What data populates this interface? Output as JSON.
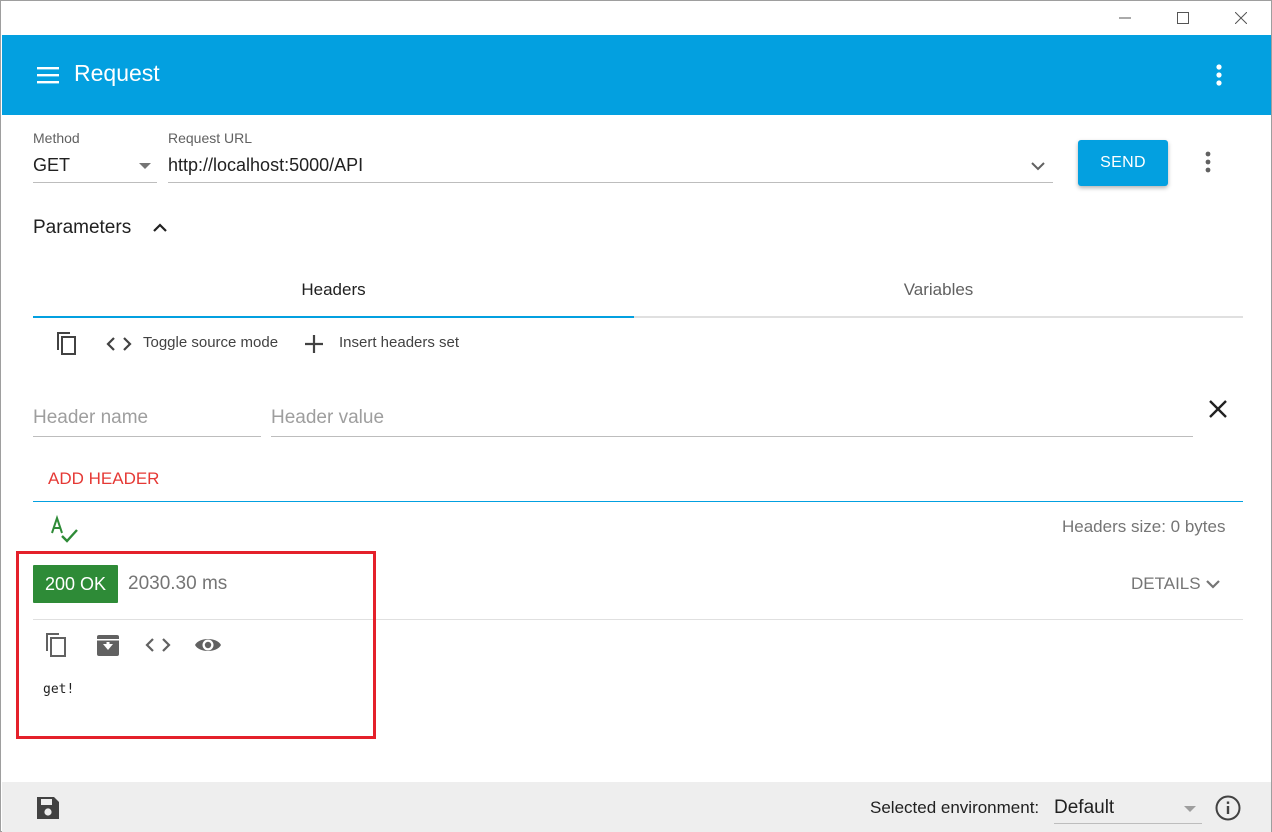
{
  "window": {
    "controls": [
      "minimize-icon",
      "maximize-icon",
      "close-icon"
    ]
  },
  "appbar": {
    "title": "Request",
    "color": "#03a0e0",
    "menu_icon": "hamburger-menu-icon",
    "more_icon": "more-vert-icon"
  },
  "request": {
    "method_label": "Method",
    "method_value": "GET",
    "url_label": "Request URL",
    "url_value": "http://localhost:5000/API",
    "send_label": "SEND"
  },
  "parameters": {
    "title": "Parameters",
    "tabs": [
      {
        "label": "Headers",
        "selected": true
      },
      {
        "label": "Variables",
        "selected": false
      }
    ],
    "toolbar": {
      "toggle_source_label": "Toggle source mode",
      "insert_headers_label": "Insert headers set"
    },
    "header_name_placeholder": "Header name",
    "header_value_placeholder": "Header value",
    "header_name_value": "",
    "header_value_value": "",
    "add_header_label": "ADD HEADER",
    "headers_size": "Headers size: 0 bytes"
  },
  "response": {
    "status": "200 OK",
    "status_color": "#2e8b37",
    "time": "2030.30 ms",
    "details_label": "DETAILS",
    "body": "get!",
    "icons": [
      "copy-icon",
      "save-download-icon",
      "code-icon",
      "preview-eye-icon"
    ]
  },
  "footer": {
    "env_label": "Selected environment:",
    "env_value": "Default",
    "icons": [
      "save-icon",
      "info-icon"
    ]
  },
  "colors": {
    "accent": "#03a0e0",
    "add_header": "#e53935",
    "highlight": "#e4202a"
  }
}
